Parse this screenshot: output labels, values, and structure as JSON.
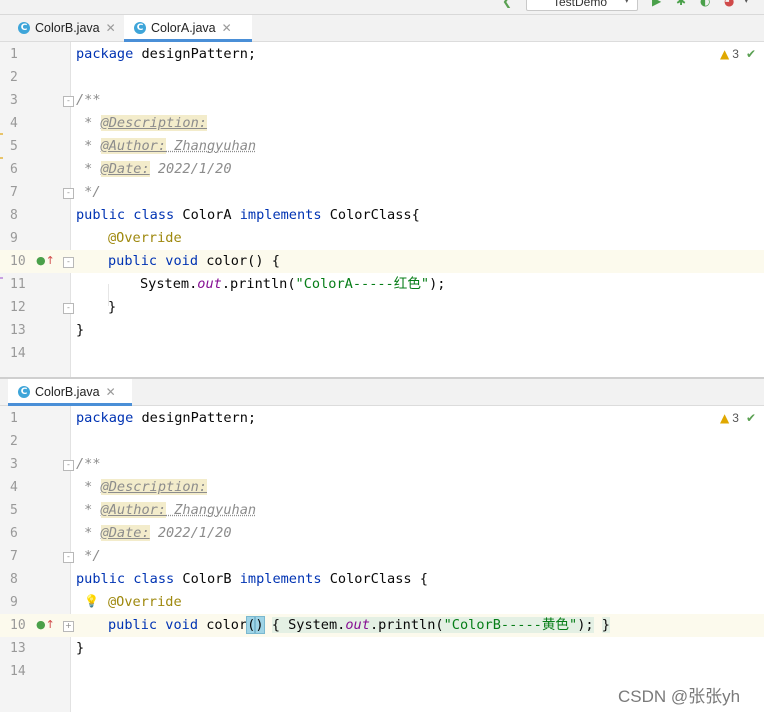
{
  "toolbar": {
    "run_config": "TestDemo"
  },
  "top_pane": {
    "tabs": [
      {
        "icon": "C",
        "label": "ColorB.java"
      },
      {
        "icon": "C",
        "label": "ColorA.java"
      }
    ],
    "warnings": "3",
    "line_numbers": [
      "1",
      "2",
      "3",
      "4",
      "5",
      "6",
      "7",
      "8",
      "9",
      "10",
      "11",
      "12",
      "13",
      "14"
    ],
    "lines": {
      "l1": [
        "package",
        " designPattern;"
      ],
      "l3": "/**",
      "l4": [
        " * ",
        "@Description:"
      ],
      "l5": [
        " * ",
        "@Author:",
        " Zhangyuhan"
      ],
      "l6": [
        " * ",
        "@Date:",
        " 2022/1/20"
      ],
      "l7": " */",
      "l8": [
        "public class",
        " ColorA ",
        "implements",
        " ColorClass{"
      ],
      "l9": "@Override",
      "l10": [
        "public void",
        " color() {"
      ],
      "l11": [
        "System.",
        "out",
        ".println(",
        "\"ColorA-----红色\"",
        ");"
      ],
      "l12": "}",
      "l13": "}"
    }
  },
  "bottom_pane": {
    "tabs": [
      {
        "icon": "C",
        "label": "ColorB.java"
      }
    ],
    "warnings": "3",
    "line_numbers": [
      "1",
      "2",
      "3",
      "4",
      "5",
      "6",
      "7",
      "8",
      "9",
      "10",
      "13",
      "14"
    ],
    "lines": {
      "l1": [
        "package",
        " designPattern;"
      ],
      "l3": "/**",
      "l4": [
        " * ",
        "@Description:"
      ],
      "l5": [
        " * ",
        "@Author:",
        " Zhangyuhan"
      ],
      "l6": [
        " * ",
        "@Date:",
        " 2022/1/20"
      ],
      "l7": " */",
      "l8": [
        "public class",
        " ColorB ",
        "implements",
        " ColorClass {"
      ],
      "l9": "@Override",
      "l10": [
        "public void",
        " color",
        "(",
        ")",
        " ",
        "{",
        " System.",
        "out",
        ".println(",
        "\"ColorB-----黄色\"",
        ");",
        " ",
        "}"
      ],
      "l13": "}"
    }
  },
  "watermark": "CSDN @张张yh"
}
